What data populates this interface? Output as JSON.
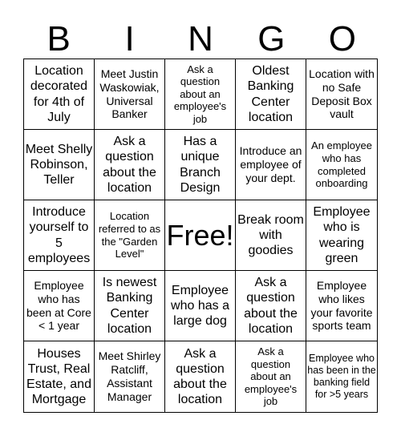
{
  "header": {
    "letters": [
      "B",
      "I",
      "N",
      "G",
      "O"
    ]
  },
  "cells": [
    "Location decorated for 4th of July",
    "Meet Justin Waskowiak, Universal Banker",
    "Ask a question about an employee's job",
    "Oldest Banking Center location",
    "Location with no Safe Deposit Box vault",
    "Meet Shelly Robinson, Teller",
    "Ask a question about the location",
    "Has a unique Branch Design",
    "Introduce an employee of your dept.",
    "An employee who has completed onboarding",
    "Introduce yourself to 5 employees",
    "Location referred to as the \"Garden Level\"",
    "Free!",
    "Break room with goodies",
    "Employee who is wearing green",
    "Employee who has been at Core < 1 year",
    "Is newest Banking Center location",
    "Employee who has a large dog",
    "Ask a question about the location",
    "Employee who likes your favorite sports team",
    "Houses Trust, Real Estate, and Mortgage",
    "Meet Shirley Ratcliff, Assistant Manager",
    "Ask a question about the location",
    "Ask a question about an employee's job",
    "Employee who has been in the banking field for >5 years"
  ]
}
